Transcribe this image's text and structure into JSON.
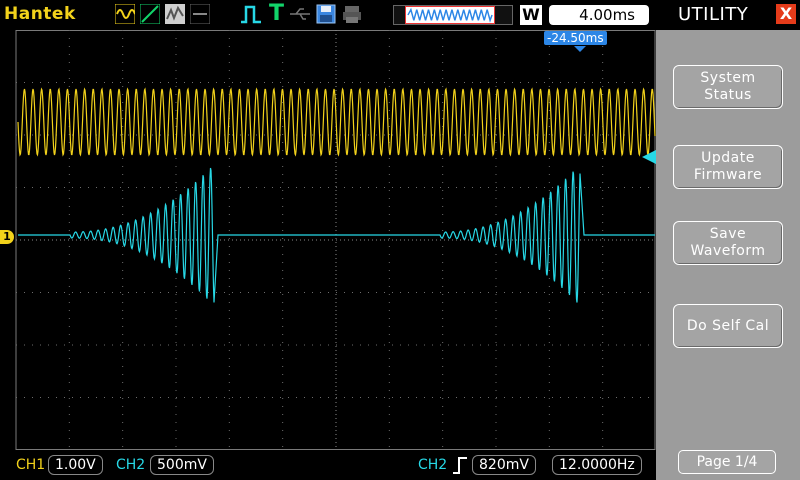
{
  "topbar": {
    "brand": "Hantek",
    "w_label": "W",
    "timebase": "4.00ms",
    "horizontal_offset": "-24.50ms",
    "icons": [
      "sine-wave-icon",
      "ramp-wave-icon",
      "noise-wave-icon",
      "cursor-icon",
      "trigger-pulse-icon",
      "trigger-t-icon",
      "usb-icon",
      "save-disk-icon",
      "printer-icon",
      "memory-buffer-icon"
    ]
  },
  "channels": {
    "ch1": {
      "label": "CH1",
      "scale": "1.00V",
      "marker": "1",
      "color": "#f2d21b"
    },
    "ch2": {
      "label": "CH2",
      "scale": "500mV",
      "color": "#27d8e6"
    }
  },
  "trigger": {
    "source": "CH2",
    "level": "820mV",
    "frequency": "12.0000Hz"
  },
  "menu": {
    "title": "UTILITY",
    "close": "X",
    "buttons": [
      {
        "line1": "System",
        "line2": "Status"
      },
      {
        "line1": "Update",
        "line2": "Firmware"
      },
      {
        "line1": "Save",
        "line2": "Waveform"
      },
      {
        "line1": "Do Self Cal",
        "line2": ""
      }
    ],
    "page": "Page 1/4"
  }
}
